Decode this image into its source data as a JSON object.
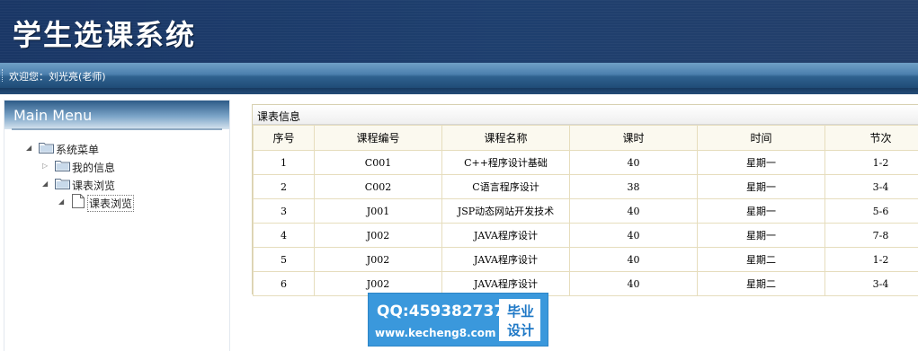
{
  "header": {
    "title": "学生选课系统"
  },
  "welcome": {
    "text": "欢迎您：刘光亮(老师)"
  },
  "sidebar": {
    "title": "Main Menu",
    "tree": {
      "root": "系统菜单",
      "my_info": "我的信息",
      "browse_group": "课表浏览",
      "browse_item": "课表浏览"
    }
  },
  "panel": {
    "title": "课表信息",
    "columns": [
      "序号",
      "课程编号",
      "课程名称",
      "课时",
      "时间",
      "节次"
    ],
    "rows": [
      [
        "1",
        "C001",
        "C++程序设计基础",
        "40",
        "星期一",
        "1-2"
      ],
      [
        "2",
        "C002",
        "C语言程序设计",
        "38",
        "星期一",
        "3-4"
      ],
      [
        "3",
        "J001",
        "JSP动态网站开发技术",
        "40",
        "星期一",
        "5-6"
      ],
      [
        "4",
        "J002",
        "JAVA程序设计",
        "40",
        "星期一",
        "7-8"
      ],
      [
        "5",
        "J002",
        "JAVA程序设计",
        "40",
        "星期二",
        "1-2"
      ],
      [
        "6",
        "J002",
        "JAVA程序设计",
        "40",
        "星期二",
        "3-4"
      ]
    ]
  },
  "watermark": {
    "qq": "QQ:459382737",
    "url": "www.kecheng8.com",
    "badge_line1": "毕业",
    "badge_line2": "设计"
  },
  "icons": {
    "tree_expanded": "triangle-down-right-icon",
    "tree_collapsed": "triangle-right-icon",
    "folder": "folder-icon",
    "page": "page-icon"
  },
  "colors": {
    "header_bg": "#1e3f6e",
    "welcome_bar": "#4c80ae",
    "table_border": "#e6ddbd",
    "watermark_bg": "#3a98dc"
  }
}
